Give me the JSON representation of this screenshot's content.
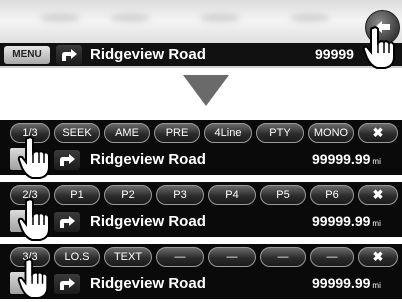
{
  "top": {
    "menu_label": "MENU",
    "road": "Ridgeview Road",
    "distance": "99999"
  },
  "panels": [
    {
      "buttons": [
        "1/3",
        "SEEK",
        "AME",
        "PRE",
        "4Line",
        "PTY",
        "MONO",
        "✖"
      ],
      "road": "Ridgeview Road",
      "distance": "99999.99",
      "unit": "mi"
    },
    {
      "buttons": [
        "2/3",
        "P1",
        "P2",
        "P3",
        "P4",
        "P5",
        "P6",
        "✖"
      ],
      "road": "Ridgeview Road",
      "distance": "99999.99",
      "unit": "mi"
    },
    {
      "buttons": [
        "3/3",
        "LO.S",
        "TEXT",
        "—",
        "—",
        "—",
        "—",
        "✖"
      ],
      "road": "Ridgeview Road",
      "distance": "99999.99",
      "unit": "mi"
    }
  ],
  "icons": {
    "back": "return-arrow-icon",
    "direction": "turn-right-arrow-icon",
    "pointer": "hand-pointer-icon",
    "transition": "down-triangle-icon"
  }
}
